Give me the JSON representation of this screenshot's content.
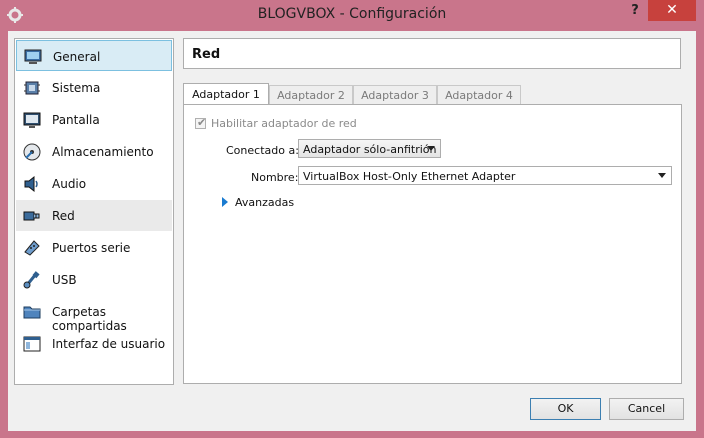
{
  "window": {
    "title": "BLOGVBOX - Configuración",
    "help_label": "?",
    "close_label": "✕"
  },
  "sidebar": {
    "items": [
      {
        "label": "General",
        "icon": "general-icon"
      },
      {
        "label": "Sistema",
        "icon": "system-icon"
      },
      {
        "label": "Pantalla",
        "icon": "display-icon"
      },
      {
        "label": "Almacenamiento",
        "icon": "storage-icon"
      },
      {
        "label": "Audio",
        "icon": "audio-icon"
      },
      {
        "label": "Red",
        "icon": "network-icon"
      },
      {
        "label": "Puertos serie",
        "icon": "serial-ports-icon"
      },
      {
        "label": "USB",
        "icon": "usb-icon"
      },
      {
        "label": "Carpetas compartidas",
        "icon": "shared-folders-icon"
      },
      {
        "label": "Interfaz de usuario",
        "icon": "user-interface-icon"
      }
    ]
  },
  "section": {
    "title": "Red"
  },
  "tabs": [
    {
      "label": "Adaptador 1"
    },
    {
      "label": "Adaptador 2"
    },
    {
      "label": "Adaptador 3"
    },
    {
      "label": "Adaptador 4"
    }
  ],
  "adapter": {
    "enable_label": "Habilitar adaptador de red",
    "attached_label": "Conectado a:",
    "attached_value": "Adaptador sólo-anfitrión",
    "name_label": "Nombre:",
    "name_value": "VirtualBox Host-Only Ethernet Adapter",
    "advanced_label": "Avanzadas"
  },
  "buttons": {
    "ok": "OK",
    "cancel": "Cancel"
  },
  "colors": {
    "titlebar": "#c9758b",
    "close": "#c7413d",
    "selected": "#d9ecf5"
  }
}
